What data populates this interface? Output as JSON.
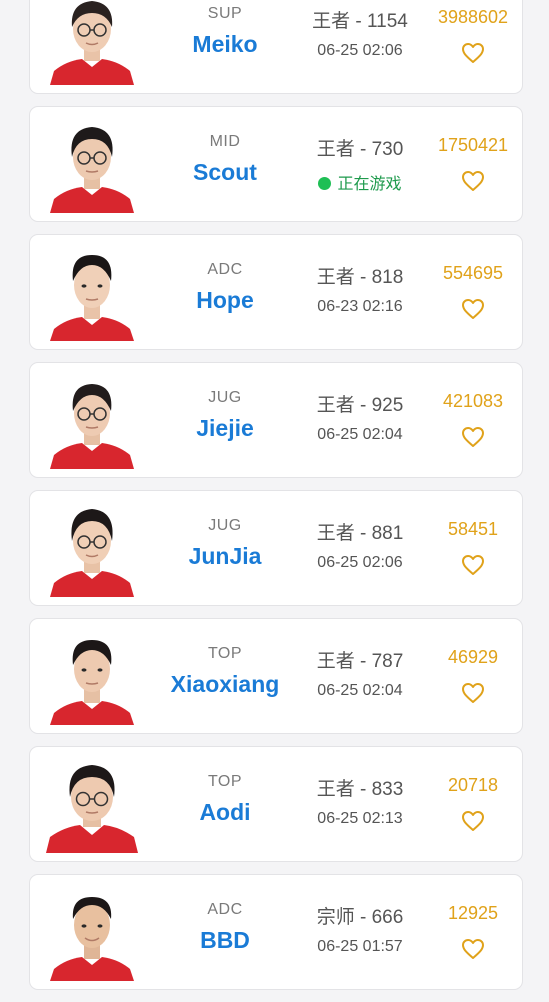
{
  "players": [
    {
      "position": "SUP",
      "name": "Meiko",
      "rank": "王者 - 1154",
      "time": "06-25 02:06",
      "score": "3988602",
      "live": false,
      "status_text": ""
    },
    {
      "position": "MID",
      "name": "Scout",
      "rank": "王者 - 730",
      "time": "",
      "score": "1750421",
      "live": true,
      "status_text": "正在游戏"
    },
    {
      "position": "ADC",
      "name": "Hope",
      "rank": "王者 - 818",
      "time": "06-23 02:16",
      "score": "554695",
      "live": false,
      "status_text": ""
    },
    {
      "position": "JUG",
      "name": "Jiejie",
      "rank": "王者 - 925",
      "time": "06-25 02:04",
      "score": "421083",
      "live": false,
      "status_text": ""
    },
    {
      "position": "JUG",
      "name": "JunJia",
      "rank": "王者 - 881",
      "time": "06-25 02:06",
      "score": "58451",
      "live": false,
      "status_text": ""
    },
    {
      "position": "TOP",
      "name": "Xiaoxiang",
      "rank": "王者 - 787",
      "time": "06-25 02:04",
      "score": "46929",
      "live": false,
      "status_text": ""
    },
    {
      "position": "TOP",
      "name": "Aodi",
      "rank": "王者 - 833",
      "time": "06-25 02:13",
      "score": "20718",
      "live": false,
      "status_text": ""
    },
    {
      "position": "ADC",
      "name": "BBD",
      "rank": "宗师 - 666",
      "time": "06-25 01:57",
      "score": "12925",
      "live": false,
      "status_text": ""
    }
  ],
  "icons": {
    "like": "heart-outline-icon",
    "live": "green-dot-icon",
    "avatar": "player-photo"
  },
  "colors": {
    "name": "#1a7bd6",
    "score": "#e0a21a",
    "live": "#1fbf55",
    "jersey": "#d8262e"
  }
}
